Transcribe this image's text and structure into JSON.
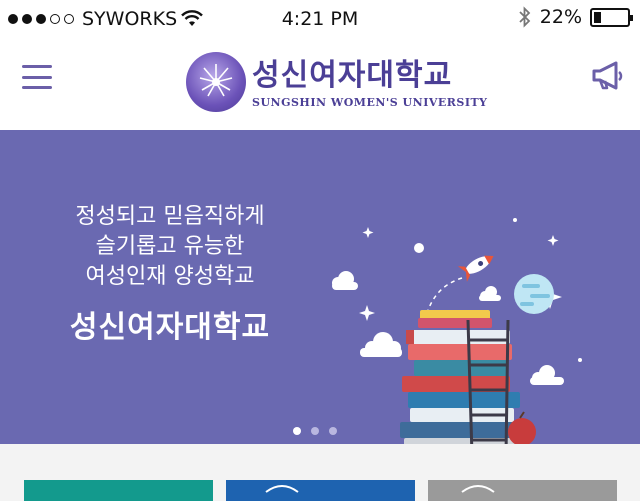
{
  "status_bar": {
    "carrier": "SYWORKS",
    "time": "4:21 PM",
    "battery": "22%",
    "battery_level": 0.22,
    "signal_dots_filled": 3,
    "signal_dots_total": 5
  },
  "header": {
    "title_ko": "성신여자대학교",
    "title_en": "SUNGSHIN WOMEN'S UNIVERSITY",
    "menu_icon": "hamburger-icon",
    "notice_icon": "megaphone-icon"
  },
  "banner": {
    "line1": "정성되고 믿음직하게",
    "line2": "슬기롭고 유능한",
    "line3": "여성인재 양성학교",
    "title": "성신여자대학교",
    "slide_count": 3,
    "active_slide": 1
  },
  "colors": {
    "brand": "#4b3f96",
    "banner": "#6a69b1",
    "tile1": "#139a8d",
    "tile2": "#1e63b0",
    "tile3": "#9a9a9a"
  }
}
